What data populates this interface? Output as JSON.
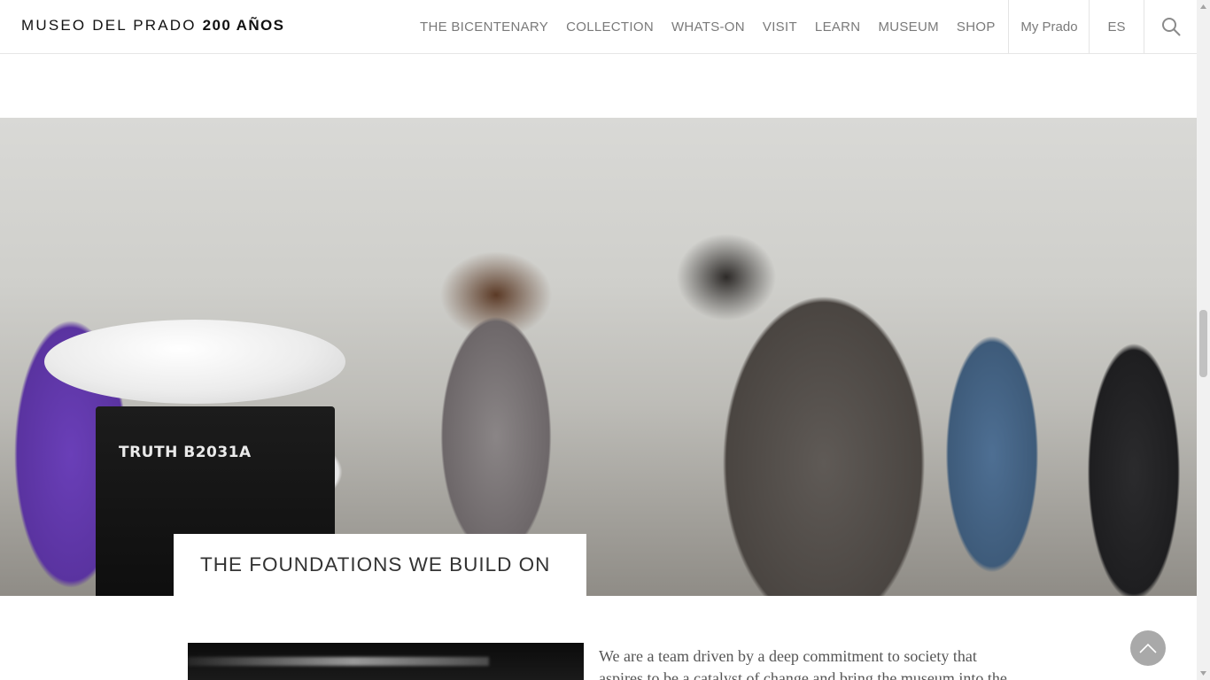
{
  "header": {
    "brand": "MUSEO DEL PRADO",
    "brand_bold": "200 AÑOS",
    "nav": [
      {
        "label": "THE BICENTENARY"
      },
      {
        "label": "COLLECTION"
      },
      {
        "label": "WHATS-ON"
      },
      {
        "label": "VISIT"
      },
      {
        "label": "LEARN"
      },
      {
        "label": "MUSEUM"
      },
      {
        "label": "SHOP"
      }
    ],
    "my_prado": "My Prado",
    "language": "ES",
    "search_icon": "search-icon"
  },
  "hero": {
    "caption": "THE FOUNDATIONS WE BUILD ON",
    "speaker_label": "TRUTH B2031A"
  },
  "intro": {
    "text": "We are a team driven by a deep commitment to society that aspires to be a catalyst of change and bring the museum into the"
  },
  "back_to_top_icon": "chevron-up-icon",
  "colors": {
    "nav_text": "#7a7a7a",
    "brand_text": "#111111",
    "back_to_top": "#a9a9a9"
  }
}
